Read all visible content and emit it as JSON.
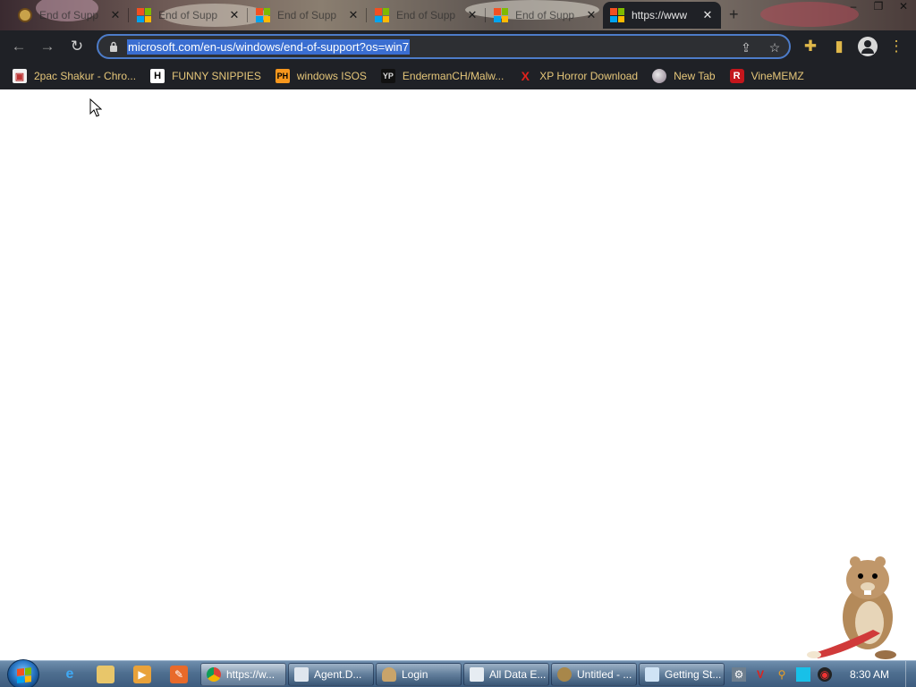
{
  "browser": {
    "tabs": [
      {
        "title": "End of Supp",
        "active": false,
        "icon": "chrome-tab-icon"
      },
      {
        "title": "End of Supp",
        "active": false,
        "icon": "microsoft-logo-icon"
      },
      {
        "title": "End of Supp",
        "active": false,
        "icon": "microsoft-logo-icon"
      },
      {
        "title": "End of Supp",
        "active": false,
        "icon": "microsoft-logo-icon"
      },
      {
        "title": "End of Supp",
        "active": false,
        "icon": "microsoft-logo-icon"
      },
      {
        "title": "https://www",
        "active": true,
        "icon": "microsoft-logo-icon"
      }
    ],
    "url": "microsoft.com/en-us/windows/end-of-support?os=win7",
    "bookmarks": [
      {
        "label": "2pac Shakur - Chro...",
        "icon": "bookmark-2pac-icon"
      },
      {
        "label": "FUNNY SNIPPIES",
        "icon": "H"
      },
      {
        "label": "windows ISOS",
        "icon": "PH"
      },
      {
        "label": "EndermanCH/Malw...",
        "icon": "YP"
      },
      {
        "label": "XP Horror Download",
        "icon": "X"
      },
      {
        "label": "New Tab",
        "icon": "globe-icon"
      },
      {
        "label": "VineMEMZ",
        "icon": "R"
      }
    ]
  },
  "taskbar": {
    "tasks": [
      {
        "label": "https://w...",
        "active": true
      },
      {
        "label": "Agent.D...",
        "active": false
      },
      {
        "label": "Login",
        "active": false
      },
      {
        "label": "All Data E...",
        "active": false
      },
      {
        "label": "Untitled - ...",
        "active": false
      },
      {
        "label": "Getting St...",
        "active": false
      }
    ],
    "clock": "8:30 AM"
  },
  "colors": {
    "toolbar_bg": "#1f2126",
    "bookmark_text": "#e6c77a",
    "url_highlight": "#3a6ed1",
    "omnibox_border": "#4d7cc9"
  }
}
